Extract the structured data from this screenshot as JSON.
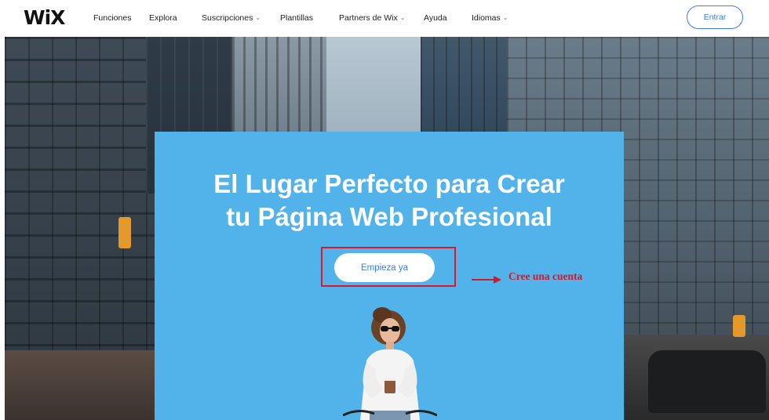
{
  "header": {
    "logo_text": "WiX",
    "nav_items": [
      {
        "label": "Funciones",
        "dropdown": false
      },
      {
        "label": "Explora",
        "dropdown": false
      },
      {
        "label": "Suscripciones",
        "dropdown": true
      },
      {
        "label": "Plantillas",
        "dropdown": false
      },
      {
        "label": "Partners de Wix",
        "dropdown": true
      },
      {
        "label": "Ayuda",
        "dropdown": false
      },
      {
        "label": "Idiomas",
        "dropdown": true
      }
    ],
    "login_label": "Entrar",
    "chevron_icon": "chevron-down-icon"
  },
  "hero": {
    "headline_line1": "El Lugar Perfecto para Crear",
    "headline_line2": "tu Página Web Profesional",
    "cta_label": "Empieza ya",
    "panel_color": "#51b3ea"
  },
  "annotation": {
    "label": "Cree una cuenta",
    "color": "#e0172b"
  },
  "colors": {
    "accent": "#3b7bf6",
    "panel": "#51b3ea",
    "annotation": "#d11a2a"
  }
}
